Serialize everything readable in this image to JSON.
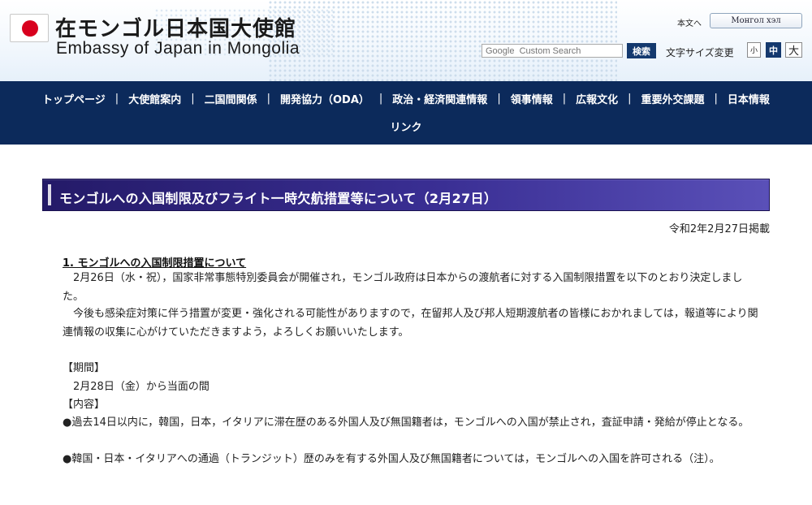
{
  "header": {
    "title_ja": "在モンゴル日本国大使館",
    "title_en": "Embassy of Japan in Mongolia",
    "lang_label": "本文へ",
    "lang_button": "Монгол хэл",
    "search_placeholder": "Google  Custom Search",
    "search_button": "検索",
    "font_size_label": "文字サイズ変更",
    "font_sizes": [
      "小",
      "中",
      "大"
    ],
    "flag_color": "#d8001e"
  },
  "nav": {
    "items": [
      "トップページ",
      "大使館案内",
      "二国間関係",
      "開発協力（ODA）",
      "政治・経済関連情報",
      "領事情報",
      "広報文化",
      "重要外交課題",
      "日本情報",
      "リンク"
    ],
    "separator": "|",
    "color": "#0c2a5b"
  },
  "content": {
    "page_title": "モンゴルへの入国制限及びフライト一時欠航措置等について（2月27日）",
    "post_date": "令和2年2月27日掲載",
    "section1_heading": "1. モンゴルへの入国制限措置について",
    "paragraph1": "2月26日（水・祝），国家非常事態特別委員会が開催され，モンゴル政府は日本からの渡航者に対する入国制限措置を以下のとおり決定しました。",
    "paragraph2": "今後も感染症対策に伴う措置が変更・強化される可能性がありますので，在留邦人及び邦人短期渡航者の皆様におかれましては，報道等により関連情報の収集に心がけていただきますよう，よろしくお願いいたします。",
    "period_label": "【期間】",
    "period_value": "2月28日（金）から当面の間",
    "content_label": "【内容】",
    "bullet1": "●過去14日以内に，韓国，日本，イタリアに滞在歴のある外国人及び無国籍者は，モンゴルへの入国が禁止され，査証申請・発給が停止となる。",
    "bullet2": "●韓国・日本・イタリアへの通過（トランジット）歴のみを有する外国人及び無国籍者については，モンゴルへの入国を許可される（注）。"
  }
}
